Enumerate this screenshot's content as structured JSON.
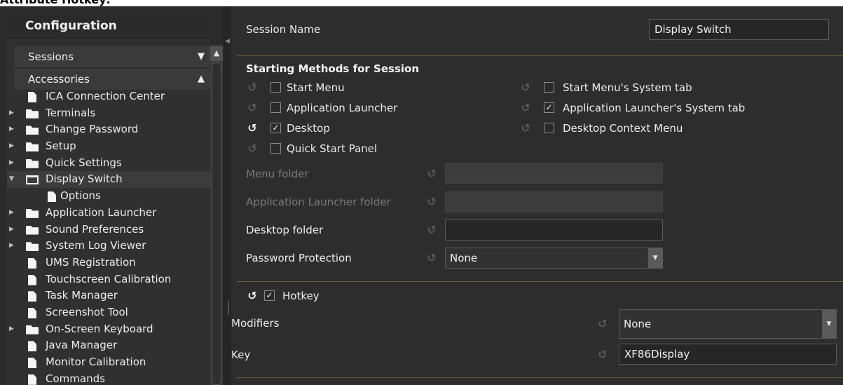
{
  "page_header": "Attribute Hotkey:",
  "sidebar": {
    "title": "Configuration",
    "sessions_label": "Sessions",
    "accessories_label": "Accessories",
    "items": [
      {
        "label": "ICA Connection Center"
      },
      {
        "label": "Terminals"
      },
      {
        "label": "Change Password"
      },
      {
        "label": "Setup"
      },
      {
        "label": "Quick Settings"
      },
      {
        "label": "Display Switch"
      },
      {
        "label": "Options"
      },
      {
        "label": "Application Launcher"
      },
      {
        "label": "Sound Preferences"
      },
      {
        "label": "System Log Viewer"
      },
      {
        "label": "UMS Registration"
      },
      {
        "label": "Touchscreen Calibration"
      },
      {
        "label": "Task Manager"
      },
      {
        "label": "Screenshot Tool"
      },
      {
        "label": "On-Screen Keyboard"
      },
      {
        "label": "Java Manager"
      },
      {
        "label": "Monitor Calibration"
      },
      {
        "label": "Commands"
      }
    ]
  },
  "session": {
    "name_label": "Session Name",
    "name_value": "Display Switch"
  },
  "starting_methods": {
    "heading": "Starting Methods for Session",
    "start_menu": "Start Menu",
    "application_launcher": "Application Launcher",
    "desktop": "Desktop",
    "quick_start_panel": "Quick Start Panel",
    "start_menu_system_tab": "Start Menu's System tab",
    "application_launcher_system_tab": "Application Launcher's System tab",
    "desktop_context_menu": "Desktop Context Menu",
    "checked_mark": "✓"
  },
  "folders": {
    "menu_folder_label": "Menu folder",
    "app_launcher_folder_label": "Application Launcher folder",
    "desktop_folder_label": "Desktop folder",
    "password_protection_label": "Password Protection",
    "password_protection_value": "None"
  },
  "hotkey": {
    "label": "Hotkey",
    "modifiers_label": "Modifiers",
    "modifiers_value": "None",
    "key_label": "Key",
    "key_value": "XF86Display"
  },
  "icons": {
    "reset": "↺"
  }
}
